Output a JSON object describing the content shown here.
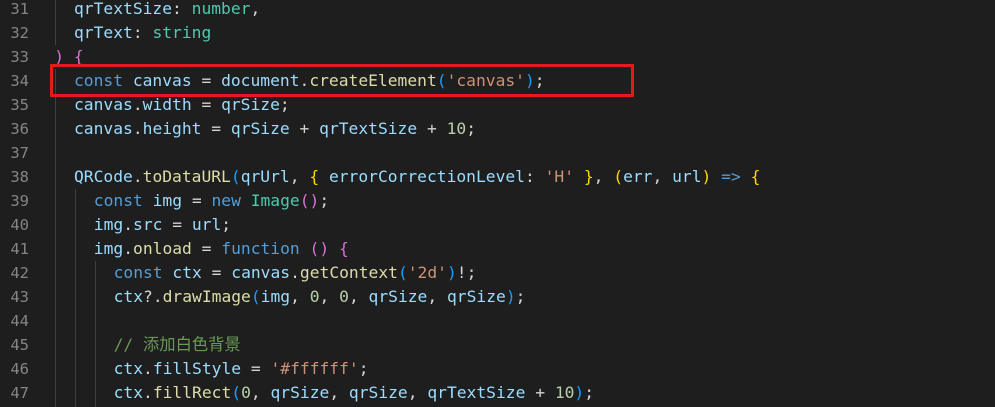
{
  "editor": {
    "lines": [
      {
        "number": "31",
        "tokens": [
          {
            "text": "qrTextSize",
            "cls": "var"
          },
          {
            "text": ": ",
            "cls": "op"
          },
          {
            "text": "number",
            "cls": "type"
          },
          {
            "text": ",",
            "cls": "op"
          }
        ]
      },
      {
        "number": "32",
        "tokens": [
          {
            "text": "qrText",
            "cls": "var"
          },
          {
            "text": ": ",
            "cls": "op"
          },
          {
            "text": "string",
            "cls": "type"
          }
        ]
      },
      {
        "number": "33",
        "tokens": [
          {
            "text": ")",
            "cls": "p2"
          },
          {
            "text": " ",
            "cls": "op"
          },
          {
            "text": "{",
            "cls": "p2"
          }
        ]
      },
      {
        "number": "34",
        "tokens": [
          {
            "text": "const",
            "cls": "kw"
          },
          {
            "text": " ",
            "cls": "op"
          },
          {
            "text": "canvas",
            "cls": "var"
          },
          {
            "text": " = ",
            "cls": "op"
          },
          {
            "text": "document",
            "cls": "var"
          },
          {
            "text": ".",
            "cls": "op"
          },
          {
            "text": "createElement",
            "cls": "fn"
          },
          {
            "text": "(",
            "cls": "p3"
          },
          {
            "text": "'canvas'",
            "cls": "str"
          },
          {
            "text": ")",
            "cls": "p3"
          },
          {
            "text": ";",
            "cls": "op"
          }
        ]
      },
      {
        "number": "35",
        "tokens": [
          {
            "text": "canvas",
            "cls": "var"
          },
          {
            "text": ".",
            "cls": "op"
          },
          {
            "text": "width",
            "cls": "var"
          },
          {
            "text": " = ",
            "cls": "op"
          },
          {
            "text": "qrSize",
            "cls": "var"
          },
          {
            "text": ";",
            "cls": "op"
          }
        ]
      },
      {
        "number": "36",
        "tokens": [
          {
            "text": "canvas",
            "cls": "var"
          },
          {
            "text": ".",
            "cls": "op"
          },
          {
            "text": "height",
            "cls": "var"
          },
          {
            "text": " = ",
            "cls": "op"
          },
          {
            "text": "qrSize",
            "cls": "var"
          },
          {
            "text": " + ",
            "cls": "op"
          },
          {
            "text": "qrTextSize",
            "cls": "var"
          },
          {
            "text": " + ",
            "cls": "op"
          },
          {
            "text": "10",
            "cls": "num"
          },
          {
            "text": ";",
            "cls": "op"
          }
        ]
      },
      {
        "number": "37",
        "tokens": []
      },
      {
        "number": "38",
        "tokens": [
          {
            "text": "QRCode",
            "cls": "var"
          },
          {
            "text": ".",
            "cls": "op"
          },
          {
            "text": "toDataURL",
            "cls": "fn"
          },
          {
            "text": "(",
            "cls": "p3"
          },
          {
            "text": "qrUrl",
            "cls": "var"
          },
          {
            "text": ", ",
            "cls": "op"
          },
          {
            "text": "{",
            "cls": "p1"
          },
          {
            "text": " ",
            "cls": "op"
          },
          {
            "text": "errorCorrectionLevel",
            "cls": "var"
          },
          {
            "text": ": ",
            "cls": "op"
          },
          {
            "text": "'H'",
            "cls": "str"
          },
          {
            "text": " ",
            "cls": "op"
          },
          {
            "text": "}",
            "cls": "p1"
          },
          {
            "text": ", ",
            "cls": "op"
          },
          {
            "text": "(",
            "cls": "p1"
          },
          {
            "text": "err",
            "cls": "var"
          },
          {
            "text": ", ",
            "cls": "op"
          },
          {
            "text": "url",
            "cls": "var"
          },
          {
            "text": ")",
            "cls": "p1"
          },
          {
            "text": " ",
            "cls": "op"
          },
          {
            "text": "=>",
            "cls": "kw"
          },
          {
            "text": " ",
            "cls": "op"
          },
          {
            "text": "{",
            "cls": "p1"
          }
        ]
      },
      {
        "number": "39",
        "tokens": [
          {
            "text": "const",
            "cls": "kw"
          },
          {
            "text": " ",
            "cls": "op"
          },
          {
            "text": "img",
            "cls": "var"
          },
          {
            "text": " = ",
            "cls": "op"
          },
          {
            "text": "new",
            "cls": "kw"
          },
          {
            "text": " ",
            "cls": "op"
          },
          {
            "text": "Image",
            "cls": "type"
          },
          {
            "text": "()",
            "cls": "p2"
          },
          {
            "text": ";",
            "cls": "op"
          }
        ]
      },
      {
        "number": "40",
        "tokens": [
          {
            "text": "img",
            "cls": "var"
          },
          {
            "text": ".",
            "cls": "op"
          },
          {
            "text": "src",
            "cls": "var"
          },
          {
            "text": " = ",
            "cls": "op"
          },
          {
            "text": "url",
            "cls": "var"
          },
          {
            "text": ";",
            "cls": "op"
          }
        ]
      },
      {
        "number": "41",
        "tokens": [
          {
            "text": "img",
            "cls": "var"
          },
          {
            "text": ".",
            "cls": "op"
          },
          {
            "text": "onload",
            "cls": "fn"
          },
          {
            "text": " = ",
            "cls": "op"
          },
          {
            "text": "function",
            "cls": "kw"
          },
          {
            "text": " ",
            "cls": "op"
          },
          {
            "text": "()",
            "cls": "p2"
          },
          {
            "text": " ",
            "cls": "op"
          },
          {
            "text": "{",
            "cls": "p2"
          }
        ]
      },
      {
        "number": "42",
        "tokens": [
          {
            "text": "const",
            "cls": "kw"
          },
          {
            "text": " ",
            "cls": "op"
          },
          {
            "text": "ctx",
            "cls": "var"
          },
          {
            "text": " = ",
            "cls": "op"
          },
          {
            "text": "canvas",
            "cls": "var"
          },
          {
            "text": ".",
            "cls": "op"
          },
          {
            "text": "getContext",
            "cls": "fn"
          },
          {
            "text": "(",
            "cls": "p3"
          },
          {
            "text": "'2d'",
            "cls": "str"
          },
          {
            "text": ")",
            "cls": "p3"
          },
          {
            "text": "!;",
            "cls": "op"
          }
        ]
      },
      {
        "number": "43",
        "tokens": [
          {
            "text": "ctx",
            "cls": "var"
          },
          {
            "text": "?.",
            "cls": "op"
          },
          {
            "text": "drawImage",
            "cls": "fn"
          },
          {
            "text": "(",
            "cls": "p3"
          },
          {
            "text": "img",
            "cls": "var"
          },
          {
            "text": ", ",
            "cls": "op"
          },
          {
            "text": "0",
            "cls": "num"
          },
          {
            "text": ", ",
            "cls": "op"
          },
          {
            "text": "0",
            "cls": "num"
          },
          {
            "text": ", ",
            "cls": "op"
          },
          {
            "text": "qrSize",
            "cls": "var"
          },
          {
            "text": ", ",
            "cls": "op"
          },
          {
            "text": "qrSize",
            "cls": "var"
          },
          {
            "text": ")",
            "cls": "p3"
          },
          {
            "text": ";",
            "cls": "op"
          }
        ]
      },
      {
        "number": "44",
        "tokens": []
      },
      {
        "number": "45",
        "tokens": [
          {
            "text": "// 添加白色背景",
            "cls": "cmt"
          }
        ]
      },
      {
        "number": "46",
        "tokens": [
          {
            "text": "ctx",
            "cls": "var"
          },
          {
            "text": ".",
            "cls": "op"
          },
          {
            "text": "fillStyle",
            "cls": "var"
          },
          {
            "text": " = ",
            "cls": "op"
          },
          {
            "text": "'#ffffff'",
            "cls": "str"
          },
          {
            "text": ";",
            "cls": "op"
          }
        ]
      },
      {
        "number": "47",
        "tokens": [
          {
            "text": "ctx",
            "cls": "var"
          },
          {
            "text": ".",
            "cls": "op"
          },
          {
            "text": "fillRect",
            "cls": "fn"
          },
          {
            "text": "(",
            "cls": "p3"
          },
          {
            "text": "0",
            "cls": "num"
          },
          {
            "text": ", ",
            "cls": "op"
          },
          {
            "text": "qrSize",
            "cls": "var"
          },
          {
            "text": ", ",
            "cls": "op"
          },
          {
            "text": "qrSize",
            "cls": "var"
          },
          {
            "text": ", ",
            "cls": "op"
          },
          {
            "text": "qrTextSize",
            "cls": "var"
          },
          {
            "text": " + ",
            "cls": "op"
          },
          {
            "text": "10",
            "cls": "num"
          },
          {
            "text": ")",
            "cls": "p3"
          },
          {
            "text": ";",
            "cls": "op"
          }
        ]
      }
    ],
    "highlighted_line": "34",
    "highlight_color": "#e8191c",
    "theme": {
      "background": "#1e1e1e",
      "line_number_color": "#858585",
      "keyword": "#569cd6",
      "variable": "#9cdcfe",
      "function": "#dcdcaa",
      "string": "#ce9178",
      "number": "#b5cea8",
      "type": "#4ec9b0",
      "comment": "#6a9955"
    }
  }
}
